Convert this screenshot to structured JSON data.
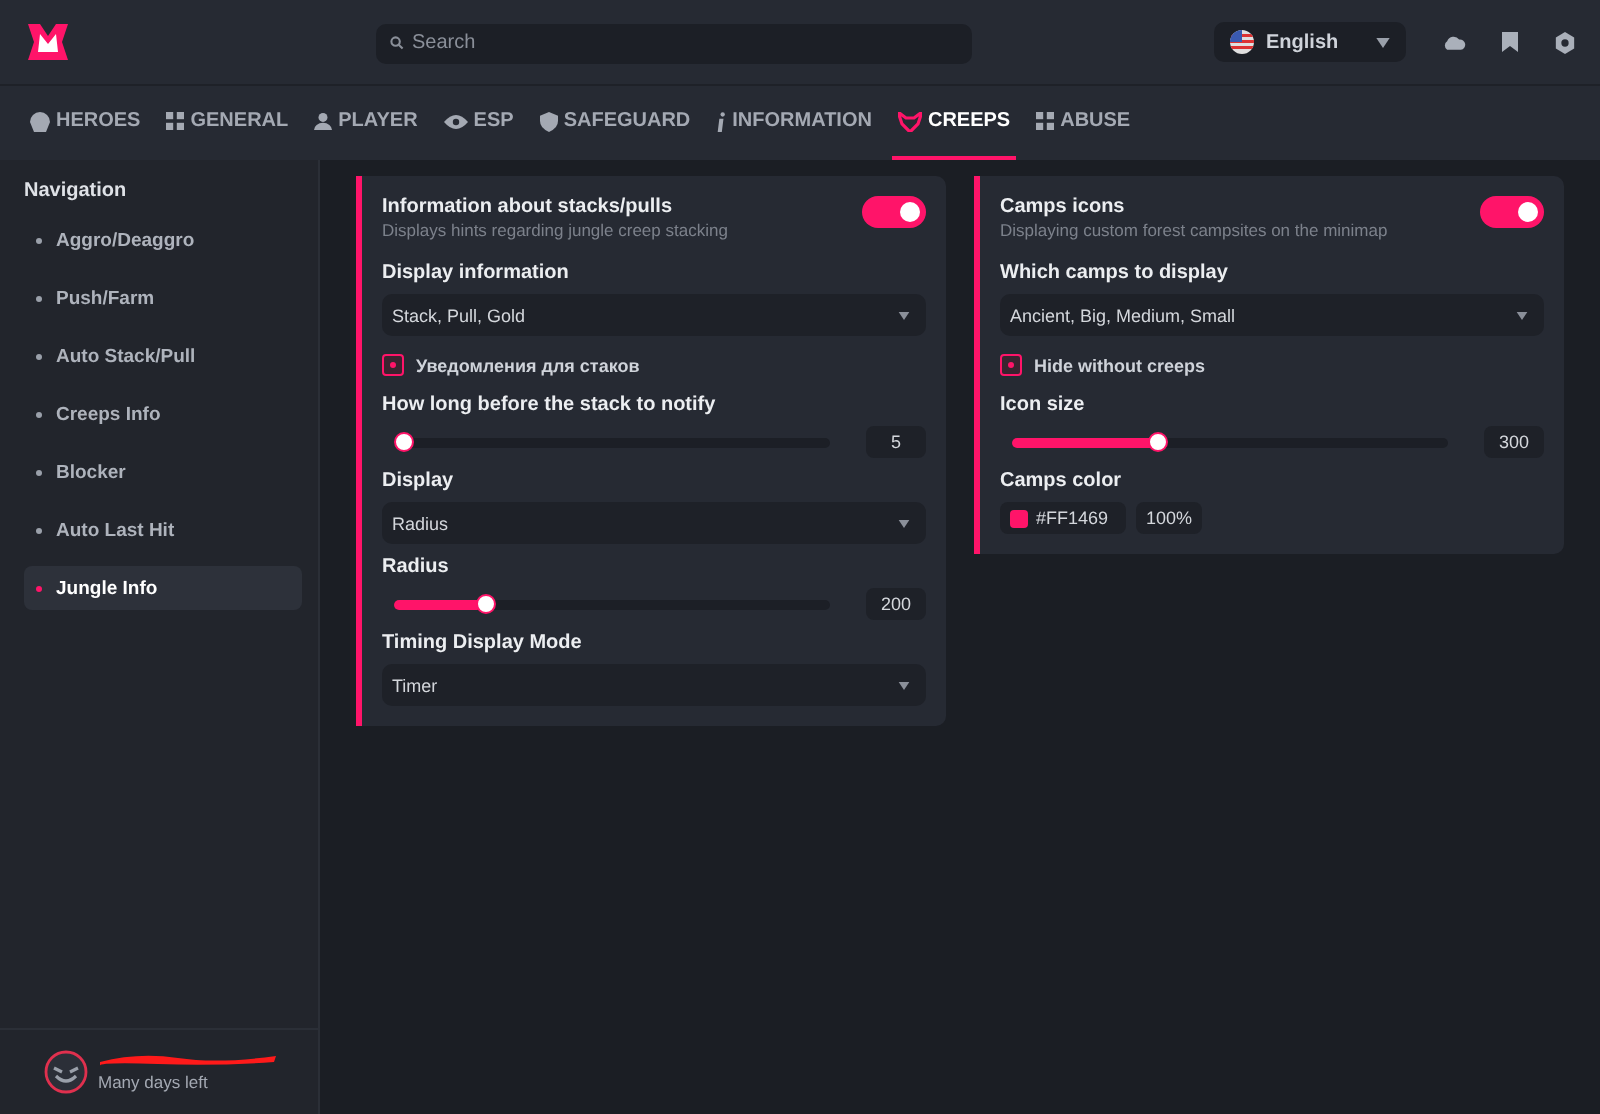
{
  "search": {
    "placeholder": "Search"
  },
  "language": {
    "value": "English"
  },
  "tabs": [
    {
      "label": "HEROES",
      "selected": false
    },
    {
      "label": "GENERAL",
      "selected": false
    },
    {
      "label": "PLAYER",
      "selected": false
    },
    {
      "label": "ESP",
      "selected": false
    },
    {
      "label": "SAFEGUARD",
      "selected": false
    },
    {
      "label": "INFORMATION",
      "selected": false
    },
    {
      "label": "CREEPS",
      "selected": true
    },
    {
      "label": "ABUSE",
      "selected": false
    }
  ],
  "sidebar": {
    "title": "Navigation",
    "items": [
      {
        "label": "Aggro/Deaggro",
        "selected": false
      },
      {
        "label": "Push/Farm",
        "selected": false
      },
      {
        "label": "Auto Stack/Pull",
        "selected": false
      },
      {
        "label": "Creeps Info",
        "selected": false
      },
      {
        "label": "Blocker",
        "selected": false
      },
      {
        "label": "Auto Last Hit",
        "selected": false
      },
      {
        "label": "Jungle Info",
        "selected": true
      }
    ]
  },
  "user": {
    "status": "Many days left"
  },
  "cards": [
    {
      "title": "Information about stacks/pulls",
      "description": "Displays hints regarding jungle creep stacking",
      "on": true,
      "items": [
        {
          "kind": "select",
          "label": "Display information",
          "value": "Stack, Pull, Gold"
        },
        {
          "kind": "checkbox",
          "label": "Уведомления для стаков",
          "checked": true
        },
        {
          "kind": "slider",
          "label": "How long before the stack to notify",
          "level": 0,
          "reading": "5"
        },
        {
          "kind": "select",
          "label": "Display",
          "value": "Radius"
        },
        {
          "kind": "slider",
          "label": "Radius",
          "level": 0.2,
          "reading": "200"
        },
        {
          "kind": "select",
          "label": "Timing Display Mode",
          "value": "Timer"
        }
      ]
    },
    {
      "title": "Camps icons",
      "description": "Displaying custom forest campsites on the minimap",
      "on": true,
      "items": [
        {
          "kind": "select",
          "label": "Which camps to display",
          "value": "Ancient, Big, Medium, Small"
        },
        {
          "kind": "checkbox",
          "label": "Hide without creeps",
          "checked": true
        },
        {
          "kind": "slider",
          "label": "Icon size",
          "level": 0.33,
          "reading": "300"
        },
        {
          "kind": "color",
          "label": "Camps color",
          "color": "#ff1469",
          "hex": "#FF1469",
          "opacity": "100%"
        }
      ]
    }
  ]
}
